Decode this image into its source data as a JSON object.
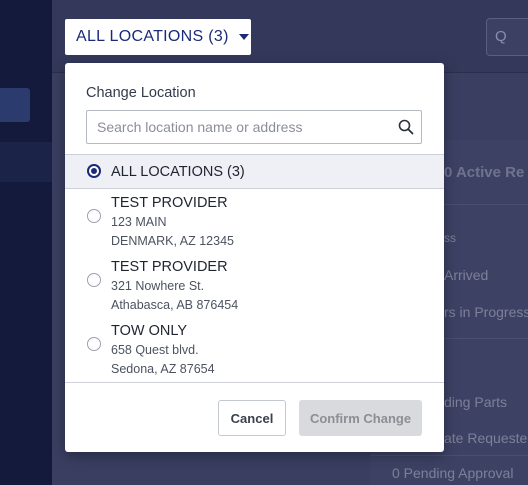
{
  "background": {
    "search_glyph": "Q",
    "active_heading": "0 Active Re",
    "stats": [
      {
        "label": "ss"
      },
      {
        "label": "Arrived"
      },
      {
        "label": "rs in Progress"
      },
      {
        "label": "ding Parts"
      },
      {
        "label": "ate Requeste"
      },
      {
        "label": "0  Pending Approval"
      }
    ]
  },
  "location_trigger": {
    "label": "ALL LOCATIONS (3)",
    "icon": "caret-down-icon"
  },
  "dropdown": {
    "title": "Change Location",
    "search": {
      "placeholder": "Search location name or address",
      "value": "",
      "icon": "search-icon"
    },
    "selected_option": {
      "label": "ALL LOCATIONS (3)"
    },
    "locations": [
      {
        "name": "TEST PROVIDER",
        "address_line1": "123 MAIN",
        "address_line2": "DENMARK, AZ 12345"
      },
      {
        "name": "TEST PROVIDER",
        "address_line1": "321 Nowhere St.",
        "address_line2": "Athabasca, AB 876454"
      },
      {
        "name": "TOW ONLY",
        "address_line1": "658 Quest blvd.",
        "address_line2": "Sedona, AZ 87654"
      }
    ],
    "cancel_label": "Cancel",
    "confirm_label": "Confirm Change"
  },
  "colors": {
    "accent": "#1b2a78",
    "overlay_bg": "#2f3357",
    "disabled_button": "#d9dadd"
  }
}
